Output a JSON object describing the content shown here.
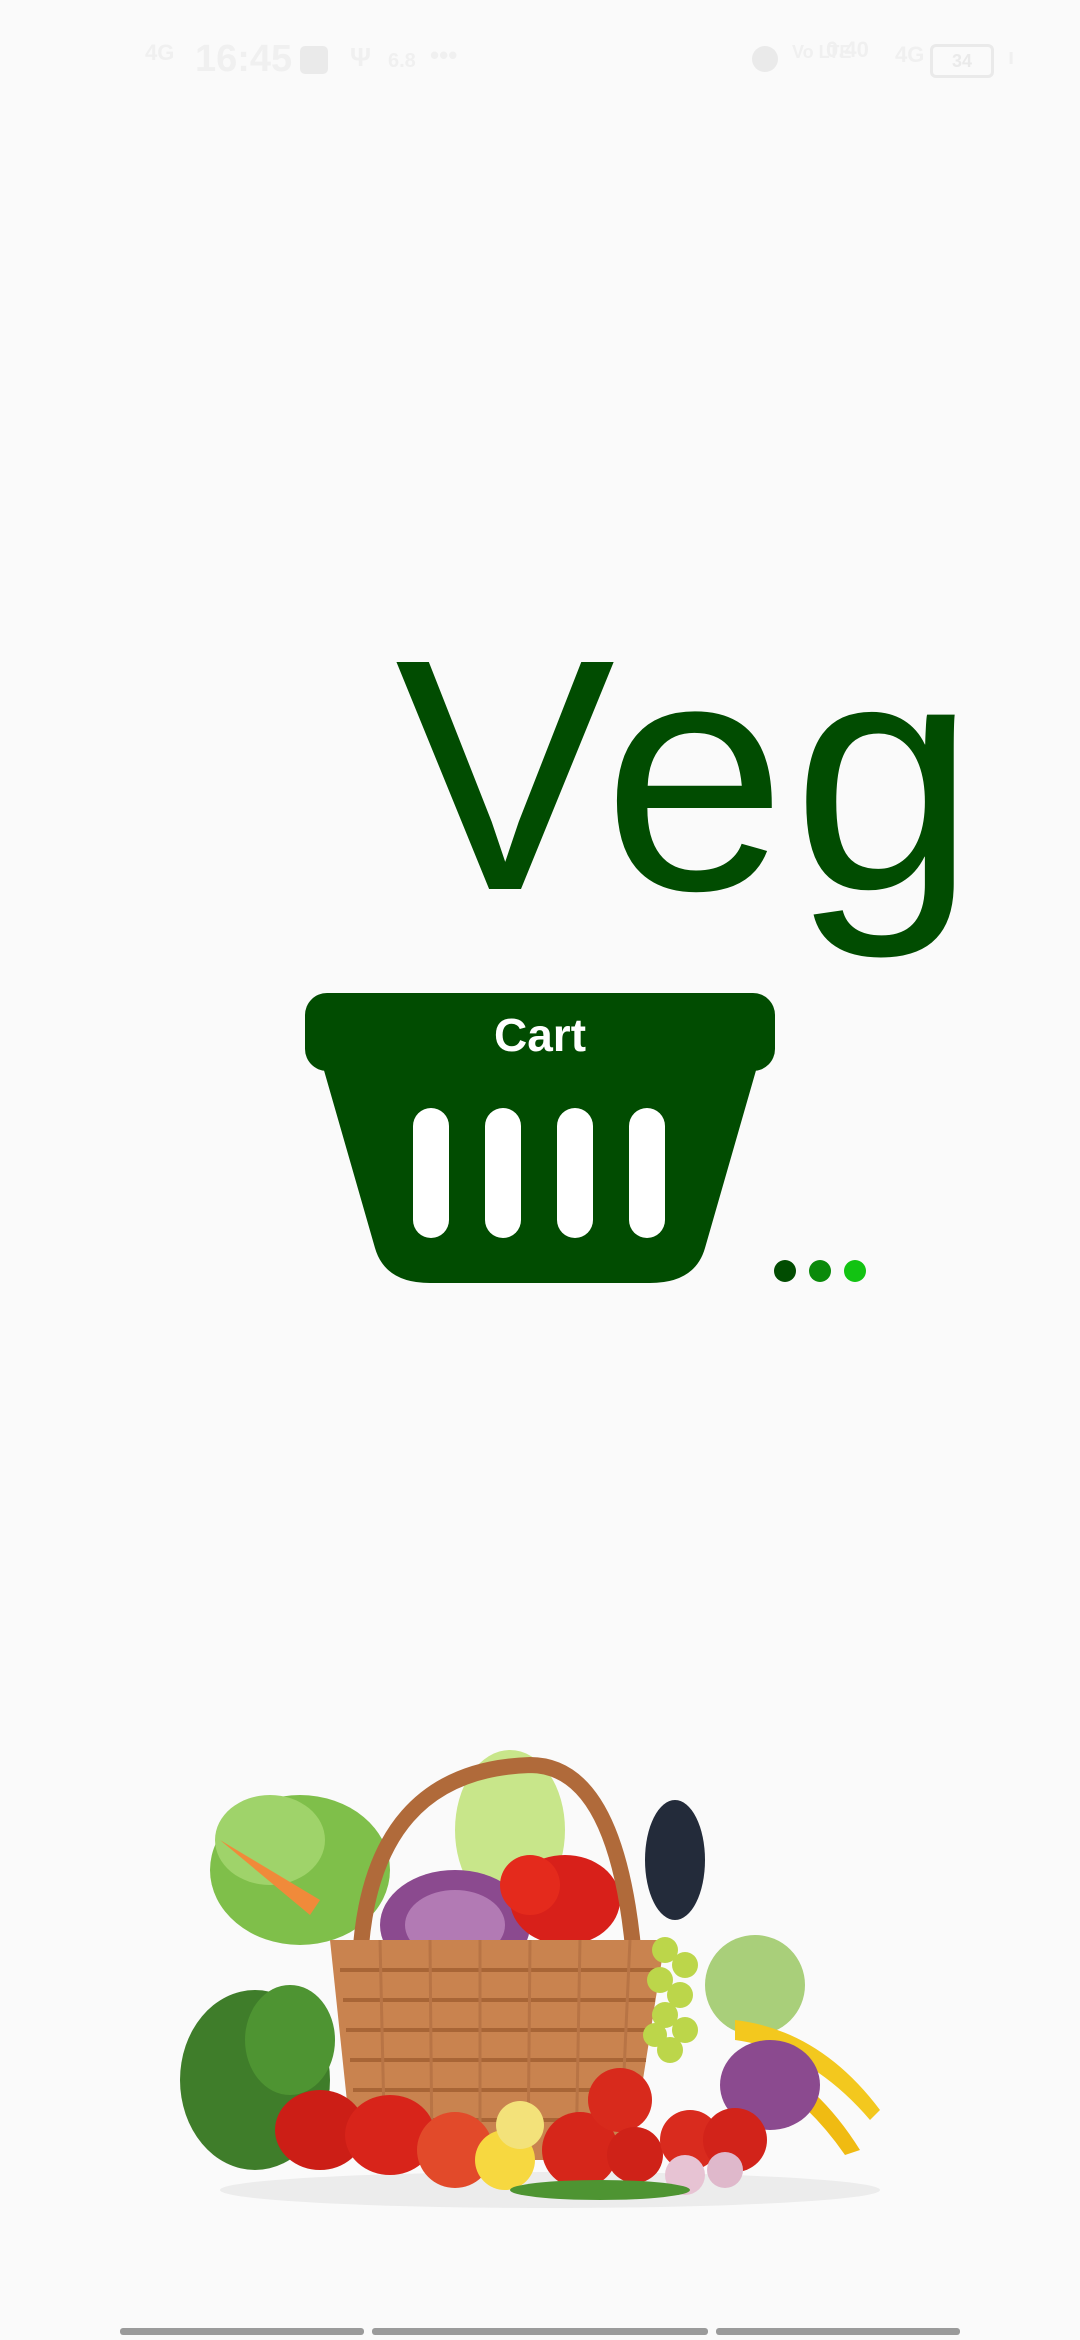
{
  "status_bar": {
    "network_left": "4G",
    "time": "16:45",
    "speed": "6.8",
    "more": "•••",
    "volte": "Vo LTE",
    "rate": "0.40",
    "network_right": "4G",
    "battery": "34"
  },
  "logo": {
    "word": "Veg",
    "cart_label": "Cart"
  },
  "loading": {
    "dot_colors": [
      "#014c01",
      "#0a8a0a",
      "#12c312"
    ]
  },
  "theme": {
    "brand_green": "#014c01",
    "background": "#fafafa"
  },
  "illustration": {
    "icon": "vegetable-basket-image"
  }
}
